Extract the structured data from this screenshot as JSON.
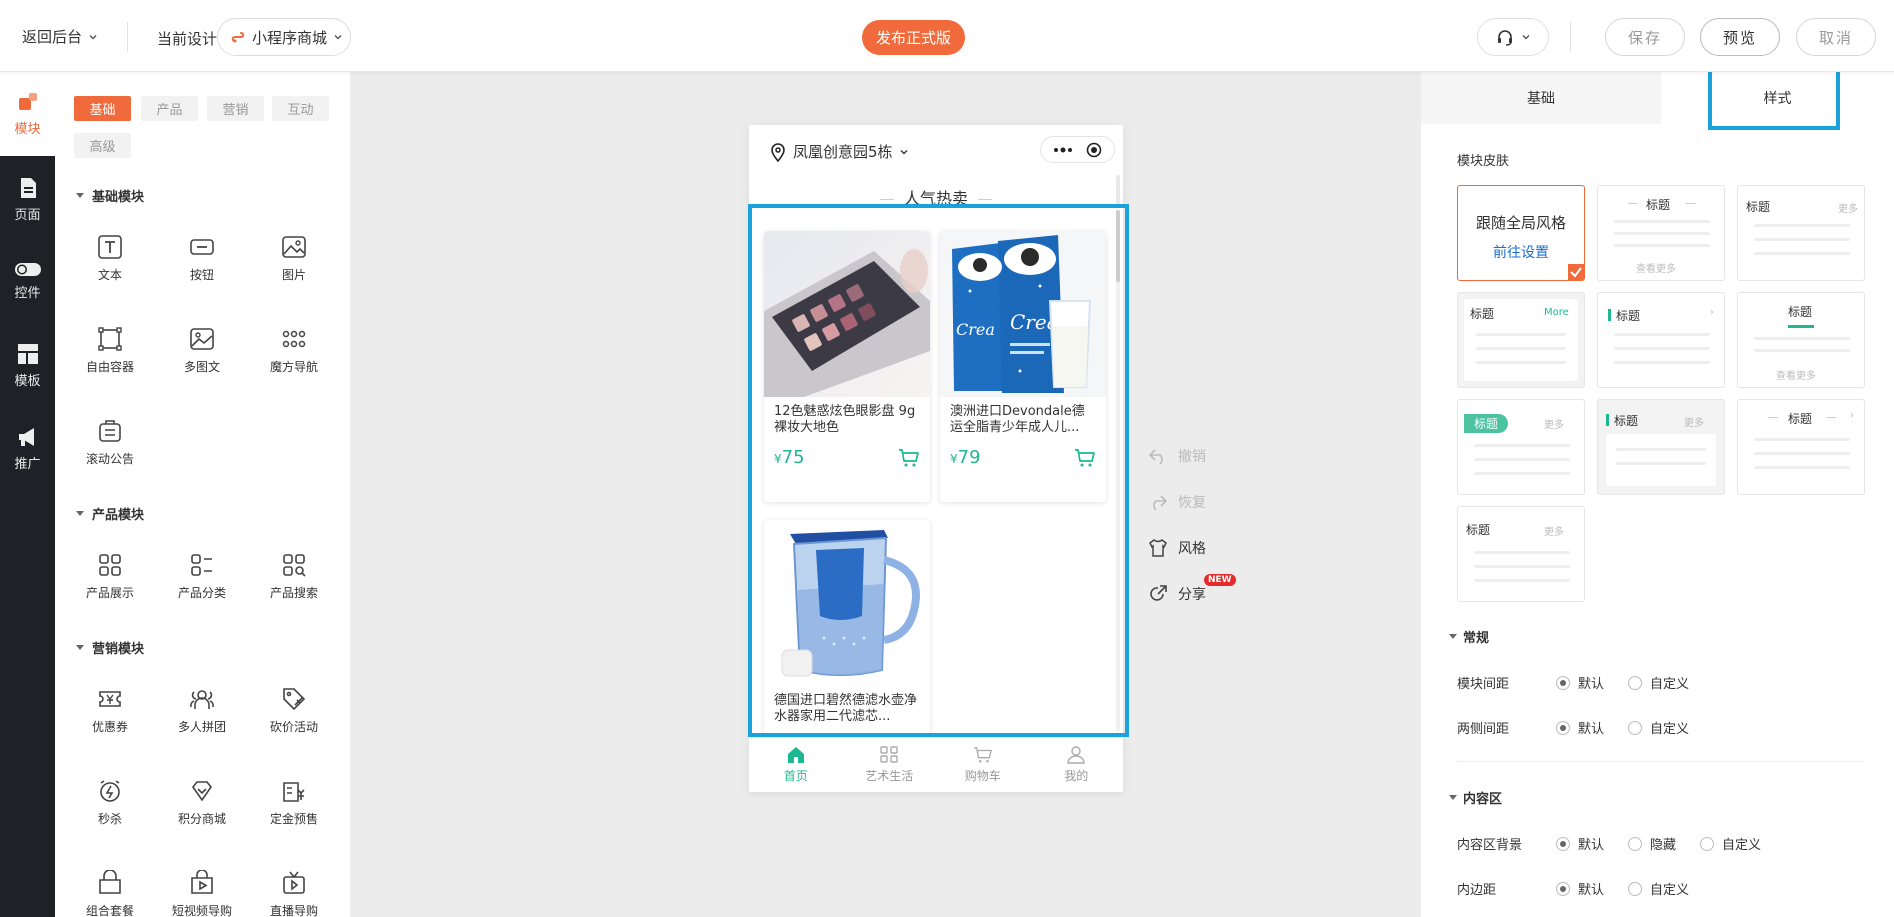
{
  "topbar": {
    "back_label": "返回后台",
    "design_label": "当前设计",
    "design_value": "小程序商城",
    "publish_label": "发布正式版",
    "save_label": "保存",
    "preview_label": "预览",
    "cancel_label": "取消"
  },
  "leftnav": {
    "items": [
      {
        "label": "模块",
        "icon": "modules-icon"
      },
      {
        "label": "页面",
        "icon": "page-icon"
      },
      {
        "label": "控件",
        "icon": "toggle-icon"
      },
      {
        "label": "模板",
        "icon": "template-icon"
      },
      {
        "label": "推广",
        "icon": "megaphone-icon"
      }
    ]
  },
  "component_panel": {
    "tabs": [
      "基础",
      "产品",
      "营销",
      "互动",
      "高级"
    ],
    "active_tab": "基础",
    "sections": [
      {
        "title": "基础模块",
        "items": [
          {
            "label": "文本",
            "icon": "text-icon"
          },
          {
            "label": "按钮",
            "icon": "button-icon"
          },
          {
            "label": "图片",
            "icon": "image-icon"
          },
          {
            "label": "自由容器",
            "icon": "container-icon"
          },
          {
            "label": "多图文",
            "icon": "multi-image-icon"
          },
          {
            "label": "魔方导航",
            "icon": "grid-dots-icon"
          },
          {
            "label": "滚动公告",
            "icon": "notice-icon"
          }
        ]
      },
      {
        "title": "产品模块",
        "items": [
          {
            "label": "产品展示",
            "icon": "product-grid-icon"
          },
          {
            "label": "产品分类",
            "icon": "category-icon"
          },
          {
            "label": "产品搜索",
            "icon": "product-search-icon"
          }
        ]
      },
      {
        "title": "营销模块",
        "items": [
          {
            "label": "优惠券",
            "icon": "coupon-icon"
          },
          {
            "label": "多人拼团",
            "icon": "group-buy-icon"
          },
          {
            "label": "砍价活动",
            "icon": "bargain-icon"
          },
          {
            "label": "秒杀",
            "icon": "flash-sale-icon"
          },
          {
            "label": "积分商城",
            "icon": "points-mall-icon"
          },
          {
            "label": "定金预售",
            "icon": "presale-icon"
          },
          {
            "label": "组合套餐",
            "icon": "bundle-icon"
          },
          {
            "label": "短视频导购",
            "icon": "short-video-icon"
          },
          {
            "label": "直播导购",
            "icon": "live-icon"
          }
        ]
      }
    ]
  },
  "phone": {
    "location": "凤凰创意园5栋",
    "section_title": "人气热卖",
    "products": [
      {
        "name": "12色魅惑炫色眼影盘 9g裸妆大地色",
        "currency": "¥",
        "price": "75"
      },
      {
        "name": "澳洲进口Devondale德运全脂青少年成人儿...",
        "currency": "¥",
        "price": "79"
      },
      {
        "name": "德国进口碧然德滤水壶净水器家用二代滤芯...",
        "currency": "¥",
        "price": ""
      }
    ],
    "tabbar": [
      {
        "label": "首页",
        "active": true
      },
      {
        "label": "艺术生活",
        "active": false
      },
      {
        "label": "购物车",
        "active": false
      },
      {
        "label": "我的",
        "active": false
      }
    ]
  },
  "tools": {
    "undo": "撤销",
    "redo": "恢复",
    "style": "风格",
    "share": "分享",
    "share_badge": "NEW"
  },
  "right_panel": {
    "tabs": [
      "基础",
      "样式"
    ],
    "active_tab": "样式",
    "skin_label": "模块皮肤",
    "skins": {
      "follow_global": "跟随全局风格",
      "go_settings": "前往设置",
      "title": "标题",
      "more": "更多",
      "view_more": "查看更多",
      "more_en": "More"
    },
    "sections": {
      "general": "常规",
      "content": "内容区"
    },
    "rows": {
      "module_spacing": "模块间距",
      "side_spacing": "两侧间距",
      "content_bg": "内容区背景",
      "padding": "内边距"
    },
    "options": {
      "default": "默认",
      "custom": "自定义",
      "hidden": "隐藏"
    }
  },
  "colors": {
    "accent": "#f06a3c",
    "highlight": "#1aa2dc",
    "price": "#1db891",
    "dark_nav": "#1f2126"
  }
}
